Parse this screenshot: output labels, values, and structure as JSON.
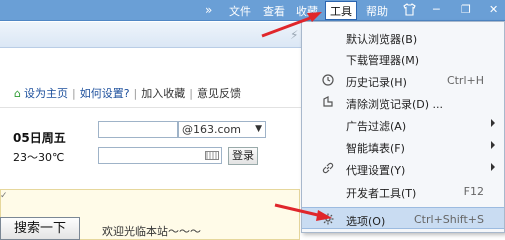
{
  "menubar": {
    "overflow": "»",
    "items": [
      "文件",
      "查看",
      "收藏",
      "工具",
      "帮助"
    ],
    "skin_icon": "shirt-icon",
    "window_controls": [
      "─",
      "❐",
      "✕"
    ]
  },
  "links": {
    "home": "设为主页",
    "setup": "如何设置?",
    "favorite": "加入收藏",
    "feedback": "意见反馈"
  },
  "weather": {
    "date": "05日周五",
    "temp": "23～30℃"
  },
  "login": {
    "domain": "@163.com",
    "button": "登录"
  },
  "search": {
    "button": "搜索一下",
    "welcome": "欢迎光临本站〜〜〜"
  },
  "dropdown": {
    "items": [
      {
        "label": "默认浏览器(B)",
        "shortcut": "",
        "icon": "",
        "submenu": false
      },
      {
        "label": "下载管理器(M)",
        "shortcut": "",
        "icon": "",
        "submenu": false
      },
      {
        "label": "历史记录(H)",
        "shortcut": "Ctrl+H",
        "icon": "clock-icon",
        "submenu": false
      },
      {
        "label": "清除浏览记录(D) ...",
        "shortcut": "",
        "icon": "eraser-icon",
        "submenu": false
      },
      {
        "label": "广告过滤(A)",
        "shortcut": "",
        "icon": "",
        "submenu": true
      },
      {
        "label": "智能填表(F)",
        "shortcut": "",
        "icon": "",
        "submenu": true
      },
      {
        "label": "代理设置(Y)",
        "shortcut": "",
        "icon": "link-icon",
        "submenu": true
      },
      {
        "label": "开发者工具(T)",
        "shortcut": "F12",
        "icon": "",
        "submenu": false
      },
      {
        "label": "选项(O)",
        "shortcut": "Ctrl+Shift+S",
        "icon": "gear-icon",
        "submenu": false
      }
    ]
  },
  "colors": {
    "menubar": "#6a9fd6",
    "highlight": "#c9dcf2",
    "arrow": "#e0262b",
    "link": "#1c4f9c"
  }
}
